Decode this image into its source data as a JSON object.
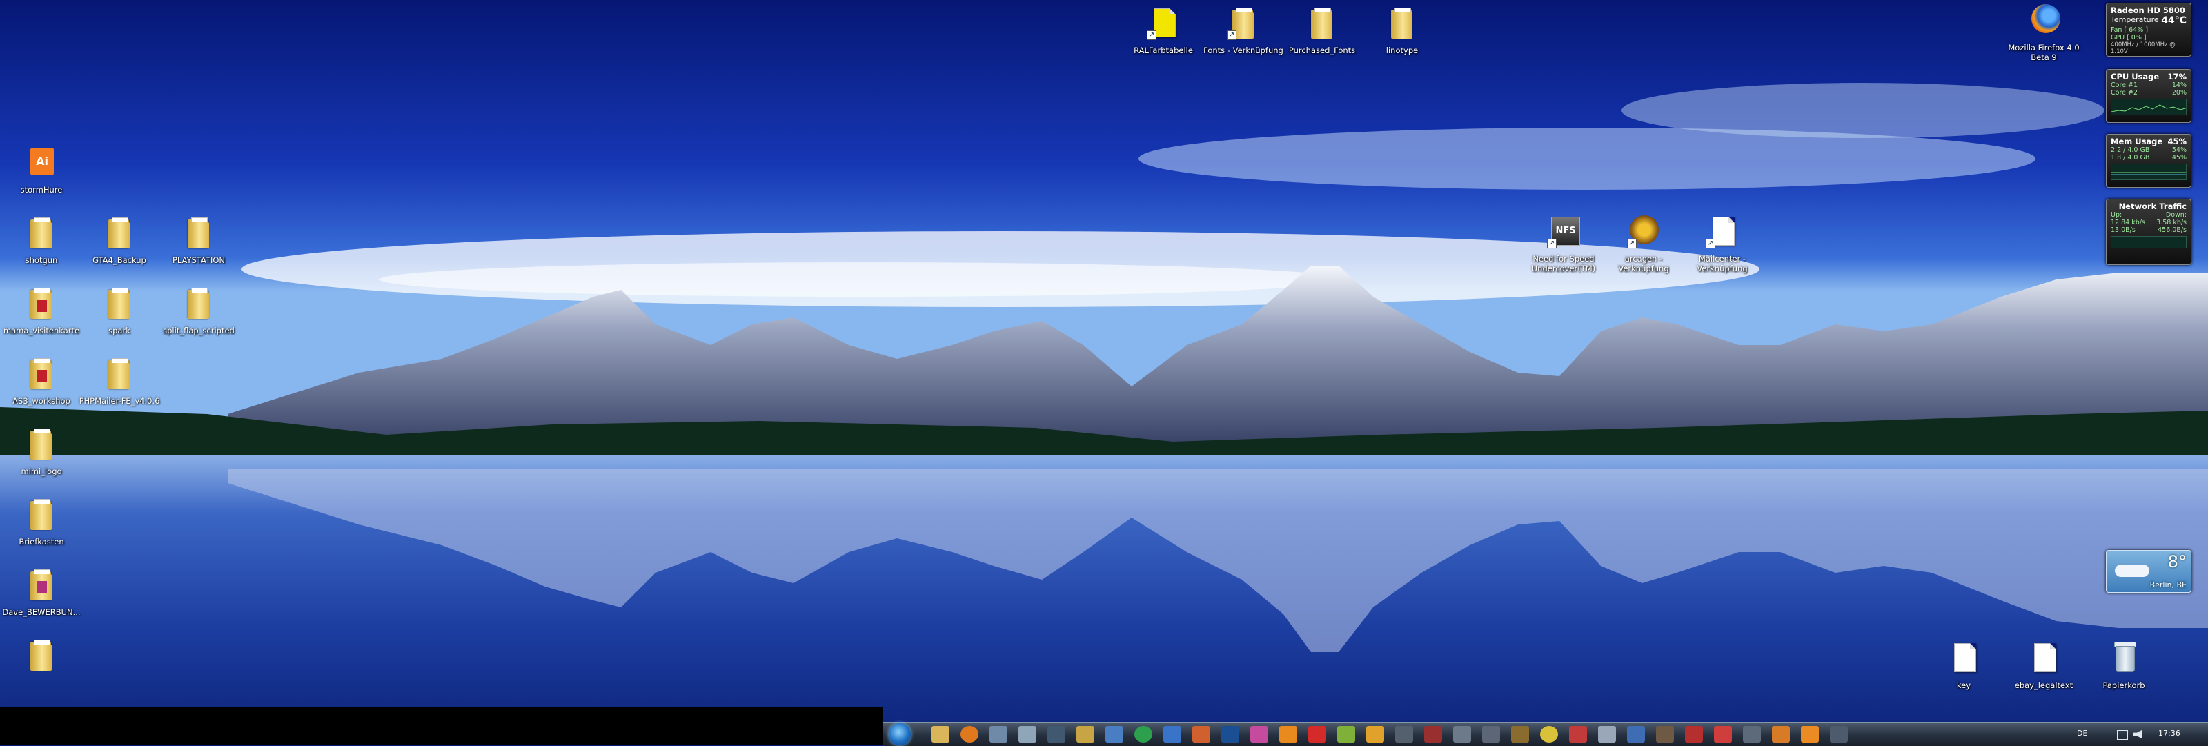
{
  "desktop": {
    "top_icons": [
      {
        "name": "RALFarbtabelle",
        "kind": "app"
      },
      {
        "name": "Fonts - Verknüpfung",
        "kind": "folder-shortcut"
      },
      {
        "name": "Purchased_Fonts",
        "kind": "folder"
      },
      {
        "name": "linotype",
        "kind": "folder"
      }
    ],
    "left_icons": [
      {
        "name": "stormHure",
        "kind": "illustrator"
      },
      {
        "name": "shotgun",
        "kind": "folder"
      },
      {
        "name": "GTA4_Backup",
        "kind": "folder"
      },
      {
        "name": "PLAYSTATION",
        "kind": "folder"
      },
      {
        "name": "mama_visitenkarte",
        "kind": "folder-pdf"
      },
      {
        "name": "spark",
        "kind": "folder"
      },
      {
        "name": "split_flap_scripted",
        "kind": "folder"
      },
      {
        "name": "AS3_workshop",
        "kind": "folder-pdf"
      },
      {
        "name": "PHPMailer-FE_v4.0.6",
        "kind": "folder"
      },
      {
        "name": "mimi_logo",
        "kind": "folder"
      },
      {
        "name": "Briefkasten",
        "kind": "folder"
      },
      {
        "name": "Dave_BEWERBUN...",
        "kind": "folder-doc"
      },
      {
        "name": "",
        "kind": "folder"
      }
    ],
    "middle_icons": [
      {
        "name": "Need for Speed\nUndercover(TM)",
        "kind": "game-shortcut"
      },
      {
        "name": "arcagen -\nVerknüpfung",
        "kind": "shortcut"
      },
      {
        "name": "Mailcenter -\nVerknüpfung",
        "kind": "doc-shortcut"
      }
    ],
    "right_icons": [
      {
        "name": "Mozilla Firefox 4.0\nBeta 9",
        "kind": "firefox"
      },
      {
        "name": "key",
        "kind": "doc"
      },
      {
        "name": "ebay_legaltext",
        "kind": "doc"
      },
      {
        "name": "Papierkorb",
        "kind": "recycle-bin"
      }
    ]
  },
  "gadgets": {
    "gpu": {
      "title": "Radeon HD 5800",
      "temp_label": "Temperature",
      "temp_value": "44°C",
      "fan": "Fan [ 64% ]",
      "gpu": "GPU [ 0% ]",
      "clock": "400MHz / 1000MHz @ 1.10V"
    },
    "cpu": {
      "title": "CPU Usage",
      "value": "17%",
      "core1": "Core #1",
      "core1_val": "14%",
      "core2": "Core #2",
      "core2_val": "20%"
    },
    "mem": {
      "title": "Mem Usage",
      "value": "45%",
      "row1": "2.2 / 4.0 GB",
      "row1_val": "54%",
      "row2": "1.8 / 4.0 GB",
      "row2_val": "45%"
    },
    "net": {
      "title": "Network Traffic",
      "up": "Up:",
      "down": "Down:",
      "up_val": "12.84 kb/s",
      "down_val": "3.58 kb/s",
      "up_total": "13.0B/s",
      "down_total": "456.0B/s"
    },
    "weather": {
      "temp": "8°",
      "city": "Berlin, BE"
    }
  },
  "taskbar": {
    "language": "DE",
    "clock": "17:36"
  }
}
